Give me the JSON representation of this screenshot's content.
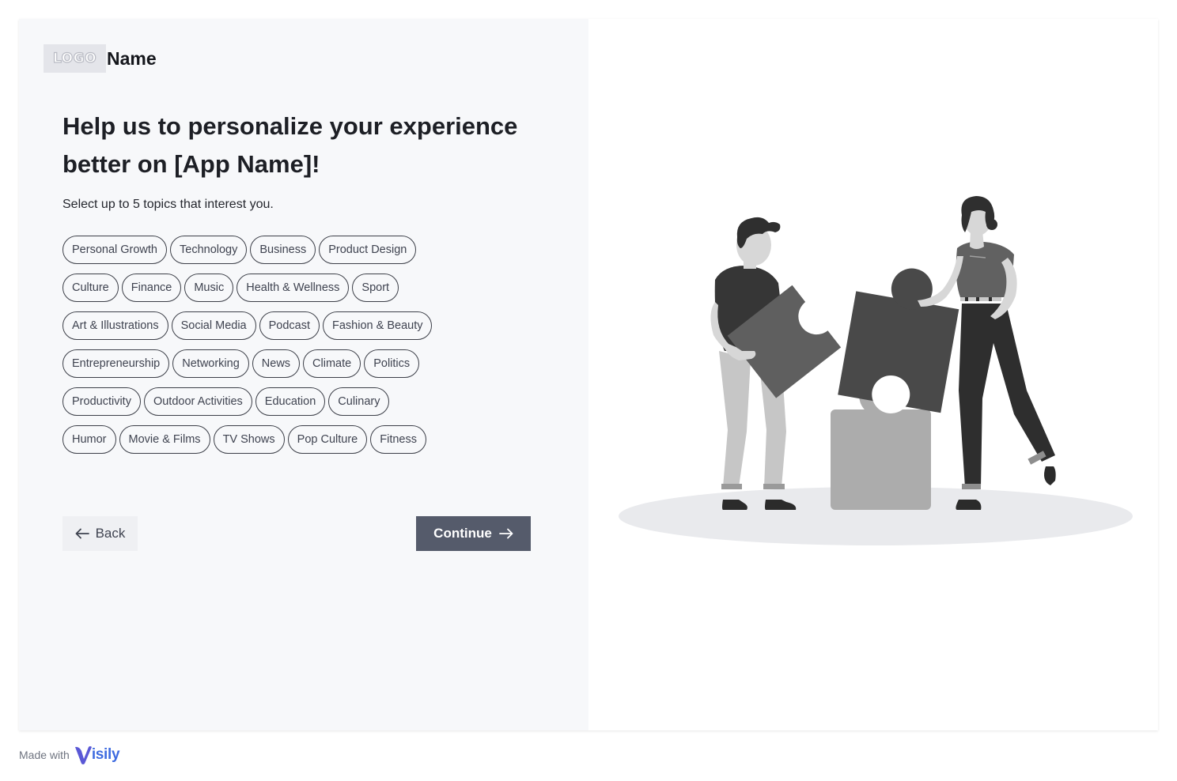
{
  "brand": {
    "logo_text": "LOGO",
    "name": "Name"
  },
  "heading": "Help us to personalize your experience better on [App Name]!",
  "subtitle": "Select up to 5 topics that interest you.",
  "topics": [
    [
      "Personal Growth",
      "Technology",
      "Business",
      "Product Design"
    ],
    [
      "Culture",
      "Finance",
      "Music",
      "Health & Wellness",
      "Sport"
    ],
    [
      "Art & Illustrations",
      "Social Media",
      "Podcast",
      "Fashion & Beauty"
    ],
    [
      "Entrepreneurship",
      "Networking",
      "News",
      "Climate",
      "Politics"
    ],
    [
      "Productivity",
      "Outdoor Activities",
      "Education",
      "Culinary"
    ],
    [
      "Humor",
      "Movie & Films",
      "TV Shows",
      "Pop Culture",
      "Fitness"
    ]
  ],
  "buttons": {
    "back_label": "Back",
    "continue_label": "Continue"
  },
  "footer": {
    "made_with": "Made with",
    "brand": "isily"
  },
  "colors": {
    "primary_button": "#555b6b",
    "left_panel": "#f7f8fa",
    "brand_blue": "#3e6be0"
  },
  "icons": {
    "back": "arrow-left-icon",
    "continue": "arrow-right-icon"
  }
}
